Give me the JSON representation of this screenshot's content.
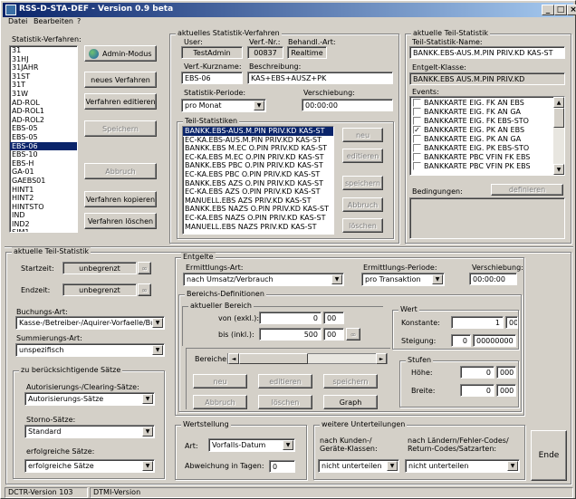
{
  "window": {
    "title": "RSS-D-STA-DEF - Version 0.9 beta",
    "min": "_",
    "max": "□",
    "close": "×"
  },
  "menu": [
    "Datei",
    "Bearbeiten",
    "?"
  ],
  "left": {
    "verfahren_label": "Statistik-Verfahren:",
    "verfahren_items": [
      "31",
      "31HJ",
      "31JAHR",
      "31ST",
      "31T",
      "31W",
      "AD-ROL",
      "AD-ROL1",
      "AD-ROL2",
      "EBS-05",
      "EBS-05",
      "EBS-06",
      "EBS-10",
      "EBS-H",
      "GA-01",
      "GAEBS01",
      "HINT1",
      "HINT2",
      "HINTSTO",
      "IND",
      "IND2",
      "SIM1"
    ],
    "selected_index": 11,
    "btn_admin": "Admin-Modus",
    "btn_neues": "neues Verfahren",
    "btn_bearbeiten": "Verfahren editieren",
    "btn_speichern": "Speichern",
    "btn_abbruch": "Abbruch",
    "btn_kopieren": "Verfahren kopieren",
    "btn_loeschen": "Verfahren löschen"
  },
  "verfahren": {
    "title": "aktuelles Statistik-Verfahren",
    "user_label": "User:",
    "user": "TestAdmin",
    "nr_label": "Verf.-Nr.:",
    "nr": "00837",
    "behand_label": "Behandl.-Art:",
    "behand": "Realtime",
    "kurz_label": "Verf.-Kurzname:",
    "kurz": "EBS-06",
    "beschr_label": "Beschreibung:",
    "beschr": "KAS+EBS+AUSZ+PK",
    "periode_label": "Statistik-Periode:",
    "periode": "pro Monat",
    "verschiebung_label": "Verschiebung:",
    "verschiebung": "00:00:00"
  },
  "teilstat": {
    "title": "Teil-Statistiken",
    "items": [
      "BANKK.EBS-AUS.M.PIN PRIV.KD KAS-ST",
      "EC-KA.EBS-AUS.M.PIN PRIV.KD KAS-ST",
      "BANKK.EBS M.EC O.PIN PRIV.KD KAS-ST",
      "EC-KA.EBS M.EC O.PIN PRIV.KD KAS-ST",
      "BANKK.EBS PBC O.PIN PRIV.KD KAS-ST",
      "EC-KA.EBS PBC O.PIN PRIV.KD KAS-ST",
      "BANKK.EBS AZS O.PIN PRIV.KD KAS-ST",
      "EC-KA.EBS AZS O.PIN PRIV.KD KAS-ST",
      "MANUELL.EBS AZS PRIV.KD KAS-ST",
      "BANKK.EBS NAZS O.PIN PRIV.KD KAS-ST",
      "EC-KA.EBS NAZS O.PIN PRIV.KD KAS-ST",
      "MANUELL.EBS NAZS PRIV.KD KAS-ST"
    ],
    "btn_neu": "neu",
    "btn_edit": "editieren",
    "btn_speichern": "speichern",
    "btn_abbruch": "Abbruch",
    "btn_loeschen": "löschen"
  },
  "right": {
    "title": "aktuelle Teil-Statistik",
    "name_label": "Teil-Statistik-Name:",
    "name": "BANKK.EBS-AUS.M.PIN PRIV.KD KAS-ST",
    "klasse_label": "Entgelt-Klasse:",
    "klasse": "BANKK.EBS AUS.M.PIN PRIV.KD",
    "events_label": "Events:",
    "events": [
      {
        "label": "BANKKARTE EIG. FK AN EBS",
        "checked": false
      },
      {
        "label": "BANKKARTE EIG. FK AN GA",
        "checked": false
      },
      {
        "label": "BANKKARTE EIG. FK EBS-STO",
        "checked": false
      },
      {
        "label": "BANKKARTE EIG. PK AN EBS",
        "checked": true
      },
      {
        "label": "BANKKARTE EIG. PK AN GA",
        "checked": false
      },
      {
        "label": "BANKKARTE EIG. PK EBS-STO",
        "checked": false
      },
      {
        "label": "BANKKARTE PBC VFIN FK EBS",
        "checked": false
      },
      {
        "label": "BANKKARTE PBC VFIN PK EBS",
        "checked": false
      }
    ],
    "bed_label": "Bedingungen:",
    "bed_btn": "definieren"
  },
  "teil2": {
    "title": "aktuelle Teil-Statistik",
    "start_label": "Startzeit:",
    "start": "unbegrenzt",
    "end_label": "Endzeit:",
    "end": "unbegrenzt",
    "inf": "∞",
    "buchungs_label": "Buchungs-Art:",
    "buchungs": "Kasse-/Betreiber-/Aquirer-Vorfaelle/Buchungen",
    "summ_label": "Summierungs-Art:",
    "summ": "unspezifisch",
    "saetze_title": "zu berücksichtigende Sätze",
    "autor_label": "Autorisierungs-/Clearing-Sätze:",
    "autor": "Autorisierungs-Sätze",
    "storno_label": "Storno-Sätze:",
    "storno": "Standard",
    "erfolg_label": "erfolgreiche Sätze:",
    "erfolg": "erfolgreiche Sätze"
  },
  "entgelte": {
    "title": "Entgelte",
    "ermittlung_label": "Ermittlungs-Art:",
    "ermittlung": "nach Umsatz/Verbrauch",
    "periode_label": "Ermittlungs-Periode:",
    "periode": "pro Transaktion",
    "versch_label": "Verschiebung:",
    "versch": "00:00:00",
    "bereich_def": "Bereichs-Definitionen",
    "akt_bereich": "aktueller Bereich",
    "von_label": "von (exkl.):",
    "von_a": "0",
    "von_b": "00",
    "bis_label": "bis (inkl.):",
    "bis_a": "500",
    "bis_b": "00",
    "bis_inf": "∞",
    "wert": "Wert",
    "konst_label": "Konstante:",
    "konst_a": "1",
    "konst_b": "00",
    "steig_label": "Steigung:",
    "steig_a": "0",
    "steig_b": "00000000",
    "stufen": "Stufen",
    "hoehe_label": "Höhe:",
    "hoehe_a": "0",
    "hoehe_b": "000",
    "breite_label": "Breite:",
    "breite_a": "0",
    "breite_b": "000",
    "bereiche_label": "Bereiche:",
    "btn_neu": "neu",
    "btn_edit": "editieren",
    "btn_speichern": "speichern",
    "btn_abbruch": "Abbruch",
    "btn_loeschen": "löschen",
    "btn_graph": "Graph"
  },
  "wertstellung": {
    "title": "Wertstellung",
    "art_label": "Art:",
    "art": "Vorfalls-Datum",
    "abw_label": "Abweichung in Tagen:",
    "abw": "0"
  },
  "unterteil": {
    "title": "weitere Unterteilungen",
    "kunden_label": "nach Kunden-/ Geräte-Klassen:",
    "kunden": "nicht unterteilen",
    "laender_label": "nach Ländern/Fehler-Codes/ Return-Codes/Satzarten:",
    "laender": "nicht unterteilen"
  },
  "ende": "Ende",
  "status": {
    "left": "DCTR-Version 103",
    "right": "DTMI-Version"
  }
}
